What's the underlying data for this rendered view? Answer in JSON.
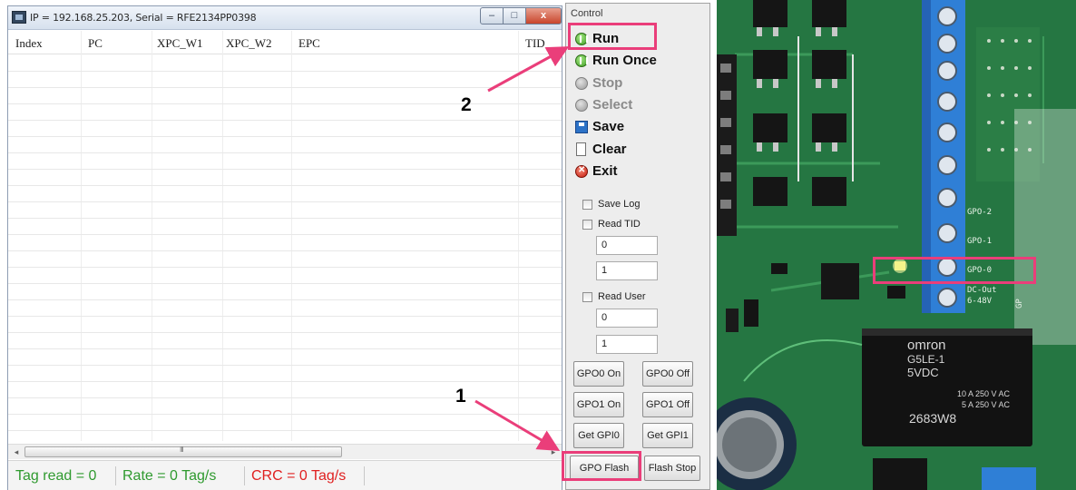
{
  "window": {
    "title": "IP = 192.168.25.203, Serial = RFE2134PP0398",
    "controls": {
      "minimize": "–",
      "maximize": "□",
      "close": "x"
    }
  },
  "table": {
    "columns": [
      "Index",
      "PC",
      "XPC_W1",
      "XPC_W2",
      "EPC",
      "TID"
    ],
    "rows": []
  },
  "scrollbar": {
    "grip": "III"
  },
  "status": {
    "tag_read": "Tag read = 0",
    "rate": "Rate = 0 Tag/s",
    "crc": "CRC = 0 Tag/s"
  },
  "control_panel": {
    "title": "Control",
    "actions": {
      "run": "Run",
      "run_once": "Run Once",
      "stop": "Stop",
      "select": "Select",
      "save": "Save",
      "clear": "Clear",
      "exit": "Exit"
    },
    "disabled_actions": [
      "stop",
      "select"
    ],
    "save_log": "Save Log",
    "read_tid": "Read TID",
    "tid_field_1": "0",
    "tid_field_2": "1",
    "read_user": "Read User",
    "user_field_1": "0",
    "user_field_2": "1",
    "buttons": {
      "gpo0_on": "GPO0 On",
      "gpo0_off": "GPO0 Off",
      "gpo1_on": "GPO1 On",
      "gpo1_off": "GPO1 Off",
      "get_gpi0": "Get GPI0",
      "get_gpi1": "Get GPI1",
      "gpo_flash": "GPO Flash",
      "flash_stop": "Flash Stop"
    }
  },
  "annotations": {
    "step_1": "1",
    "step_2": "2",
    "color": "#ea3e7a"
  },
  "photo": {
    "board_labels": {
      "gpo_2": "GPO-2",
      "gpo_1": "GPO-1",
      "gpo_0": "GPO-0",
      "dc_out": "DC-Out",
      "voltage": "6-48V",
      "side_label": "GP"
    },
    "relay": {
      "brand": "omron",
      "model": "G5LE-1",
      "voltage": "5VDC",
      "rating_1": "10 A 250 V AC",
      "rating_2": "5 A 250 V AC",
      "code": "2683W8"
    }
  }
}
